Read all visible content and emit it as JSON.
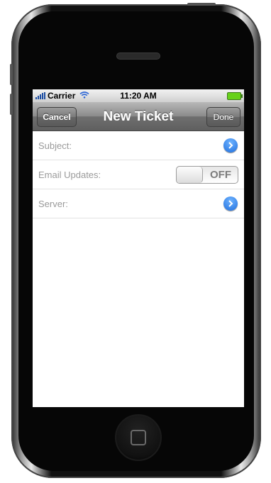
{
  "status_bar": {
    "carrier": "Carrier",
    "time": "11:20 AM",
    "wifi_icon": "wifi-icon",
    "signal_icon": "signal-bars-icon",
    "battery_icon": "battery-icon"
  },
  "nav": {
    "title": "New Ticket",
    "left_button": "Cancel",
    "right_button": "Done"
  },
  "form": {
    "rows": [
      {
        "label": "Subject:",
        "accessory": "disclosure"
      },
      {
        "label": "Email Updates:",
        "accessory": "switch",
        "switch_state": "OFF"
      },
      {
        "label": "Server:",
        "accessory": "disclosure"
      }
    ]
  },
  "colors": {
    "nav_bar": "#6f6f6f",
    "disclosure_blue": "#1f6fde",
    "battery_green": "#67d11a"
  }
}
